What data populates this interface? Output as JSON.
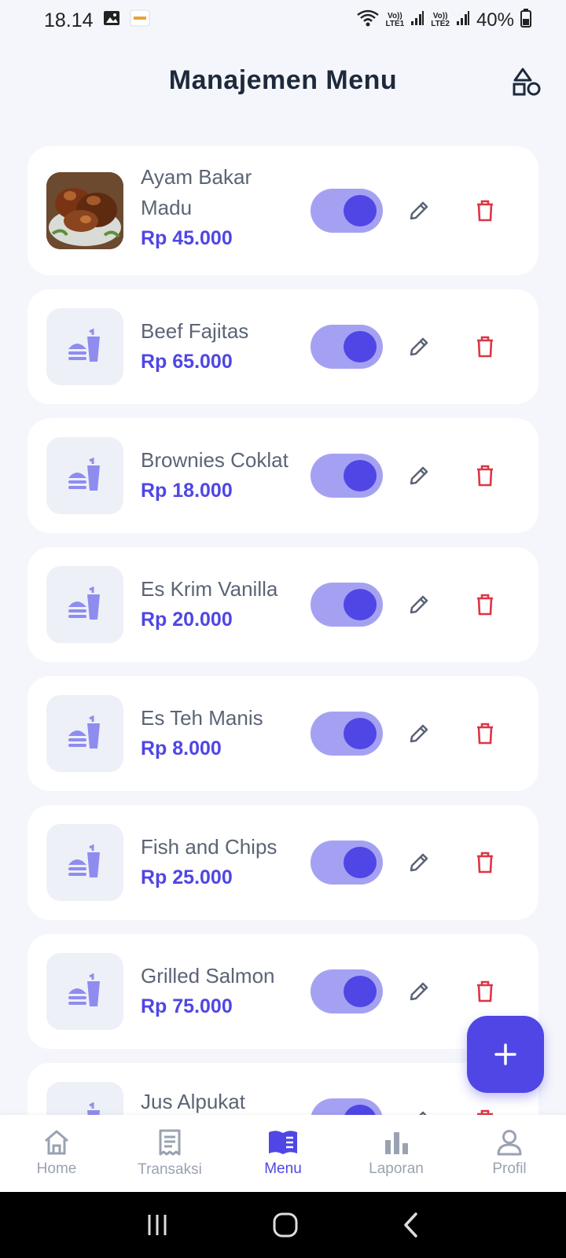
{
  "status_bar": {
    "time": "18.14",
    "sim1_top": "Vo))",
    "sim1_bottom": "LTE1",
    "sim2_top": "Vo))",
    "sim2_bottom": "LTE2",
    "battery": "40%"
  },
  "header": {
    "title": "Manajemen Menu",
    "right_icon": "shapes-icon"
  },
  "menu_items": [
    {
      "name": "Ayam Bakar Madu",
      "price": "Rp 45.000",
      "active": true,
      "has_photo": true
    },
    {
      "name": "Beef Fajitas",
      "price": "Rp 65.000",
      "active": true,
      "has_photo": false
    },
    {
      "name": "Brownies Coklat",
      "price": "Rp 18.000",
      "active": true,
      "has_photo": false
    },
    {
      "name": "Es Krim Vanilla",
      "price": "Rp 20.000",
      "active": true,
      "has_photo": false
    },
    {
      "name": "Es Teh Manis",
      "price": "Rp 8.000",
      "active": true,
      "has_photo": false
    },
    {
      "name": "Fish and Chips",
      "price": "Rp 25.000",
      "active": true,
      "has_photo": false
    },
    {
      "name": "Grilled Salmon",
      "price": "Rp 75.000",
      "active": true,
      "has_photo": false
    },
    {
      "name": "Jus Alpukat",
      "price": "",
      "active": true,
      "has_photo": false
    }
  ],
  "fab": {
    "label": "+"
  },
  "bottom_nav": [
    {
      "label": "Home",
      "icon": "home-icon",
      "active": false
    },
    {
      "label": "Transaksi",
      "icon": "receipt-icon",
      "active": false
    },
    {
      "label": "Menu",
      "icon": "book-icon",
      "active": true
    },
    {
      "label": "Laporan",
      "icon": "bar-chart-icon",
      "active": false
    },
    {
      "label": "Profil",
      "icon": "user-icon",
      "active": false
    }
  ],
  "colors": {
    "accent": "#4f46e5",
    "toggle_track": "#a5a1f2",
    "delete": "#dc3545",
    "background": "#f4f6fb"
  }
}
